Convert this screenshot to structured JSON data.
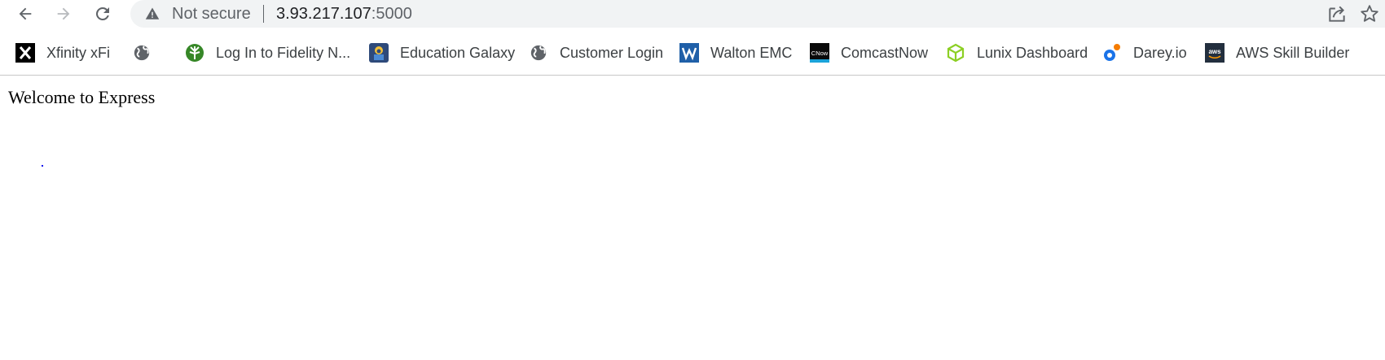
{
  "browser": {
    "security_label": "Not secure",
    "url_host": "3.93.217.107",
    "url_port": ":5000",
    "icons": {
      "back": "arrow-left",
      "forward": "arrow-right",
      "reload": "reload",
      "security": "warning-triangle",
      "share": "share",
      "bookmark": "star"
    }
  },
  "bookmarks": [
    {
      "label": "Xfinity xFi",
      "icon": "xfinity-x",
      "color": "#000000"
    },
    {
      "label": "",
      "icon": "globe",
      "color": "#5f6368"
    },
    {
      "label": "Log In to Fidelity N...",
      "icon": "fidelity-tree",
      "color": "#368727"
    },
    {
      "label": "Education Galaxy",
      "icon": "education-galaxy",
      "color": "#2e4a7a"
    },
    {
      "label": "Customer Login",
      "icon": "globe",
      "color": "#5f6368"
    },
    {
      "label": "Walton EMC",
      "icon": "walton-w",
      "color": "#1f5fa8"
    },
    {
      "label": "ComcastNow",
      "icon": "cnow",
      "color": "#0a0a0a"
    },
    {
      "label": "Lunix Dashboard",
      "icon": "lunix-cube",
      "color": "#8ccf24"
    },
    {
      "label": "Darey.io",
      "icon": "darey",
      "color": "#1a73e8"
    },
    {
      "label": "AWS Skill Builder",
      "icon": "aws",
      "color": "#232f3e"
    }
  ],
  "page": {
    "title": "Welcome to Express"
  }
}
